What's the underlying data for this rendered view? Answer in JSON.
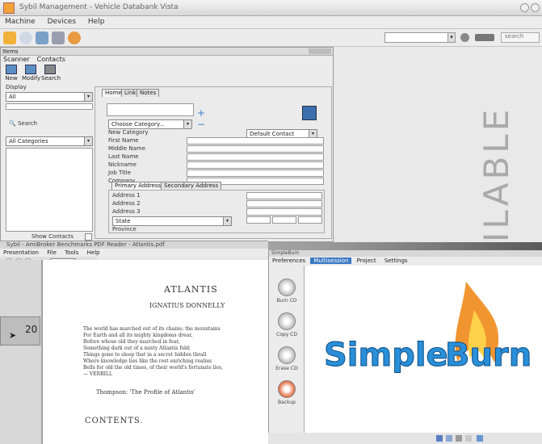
{
  "main": {
    "title": "Sybil Management - Vehicle Databank Vista",
    "menu": [
      "Machine",
      "Devices",
      "Help"
    ],
    "toolbar_search": "search"
  },
  "form": {
    "window_title": "Items",
    "menu": [
      "Scanner",
      "Contacts"
    ],
    "buttons": [
      "New",
      "Modify",
      "Search"
    ],
    "filter_label": "Display",
    "filter_value": "All",
    "search_label": "Search",
    "category_list_value": "All Categories",
    "show_contacts_label": "Show Contacts",
    "tabs": [
      "Home",
      "Links",
      "Notes"
    ],
    "category_select": "Choose Category...",
    "new_category": "New Category",
    "default_label": "Default Contact",
    "fields": [
      "First Name",
      "Middle Name",
      "Last Name",
      "Nickname",
      "Job Title",
      "Company"
    ],
    "address_tabs": [
      "Primary Address",
      "Secondary Address"
    ],
    "address_fields": [
      "Address 1",
      "Address 2",
      "Address 3"
    ],
    "state_value": "State",
    "province_label": "Province"
  },
  "atlantis": {
    "title": "Sybil - AmiBroker Benchmarks PDF Reader - Atlantis.pdf",
    "menu": [
      "Presentation",
      "File",
      "Tools",
      "Help"
    ],
    "doc_title": "ATLANTIS",
    "doc_author": "IGNATIUS DONNELLY",
    "poem": [
      "The world has marched out of its chains; the mountains",
      "For Earth and all its mighty kingdoms drear,",
      "Before whose old they marched in fear,",
      "Something dark out of a misty Atlantis fold;",
      "Things gone to sleep that in a secret hidden thrall",
      "Where knowledge lies like the rest enriching realms",
      "Bells for old the old times, of their world's fortunate lies,",
      "— VERRILL"
    ],
    "epigraph": "Thompson: 'The Profile of Atlantis'",
    "contents": "CONTENTS.",
    "zoom_value": "20"
  },
  "simpleburn": {
    "title": "SimpleBurn",
    "menu": [
      "Preferences",
      "Multisession",
      "Project",
      "Settings"
    ],
    "side_items": [
      "Burn CD",
      "Copy CD",
      "Erase CD",
      "Backup"
    ],
    "logo_text_1": "Simple",
    "logo_text_2": "Burn",
    "brand_blue": "#2a8fd8",
    "flame_orange": "#f08a1a"
  },
  "watermark": "ILABLE"
}
